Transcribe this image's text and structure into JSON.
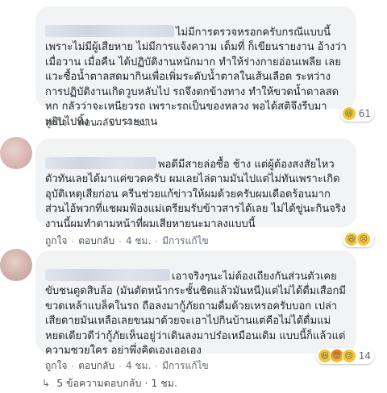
{
  "comments": [
    {
      "text": "ไม่มีการตรวจหรอกครับกรณีแบบนี้ เพราะไม่มีผู้เสียหาย ไม่มีการแจ้งความ เต็มที่ ก็เขียนรายงาน อ้างว่าเมื่อวาน เมื่อคืน ได้ปฏิบัติงานหนักมาก ทำให้ร่างกายอ่อนเพลีย เลยแวะซื้อน้ำตาลสดมากินเพื่อเพิ่มระดับน้ำตาลในเส้นเลือด ระหว่างการปฏิบัติงานเกิดวูบหลับไป รถจึงตกข้างทาง ทำให้ขวดน้ำตาลสดหก กลัวว่าจะเหนียวรถ เพราะรถเป็นของหลวง พอได้สติจึงรีบมาหยิบไปทิ้ง .... จบรายงาน",
      "like": "ถูกใจ",
      "reply": "ตอบกลับ",
      "time": "4 ชม.",
      "edited": "",
      "reactions": [
        "laugh-emoji"
      ],
      "reaction_count": "61"
    },
    {
      "text": "พอดีมีสายล่อซื้อ ช้าง แต่ผู้ต้องสงสัยไหวตัวทันเลยได้มาแค่ขวดครับ ผมเลยไล่ตามมันไปแต่ไม่ทันเพราะเกิดอุบัติเหตุเสียก่อน ครีนช่วยแก้ข่าวให้ผมด้วยครับผมเดือดร้อนมาก ส่วนไอ้พวกที่แชผมฟ้องแม่เตรียมรับข้าวสารได้เลย ไม่ได้ขู่นะกินจริง งานนี้ผมทำตามหน้าที่ผมเสียหายนะมาลงแบบนี้",
      "like": "ถูกใจ",
      "reply": "ตอบกลับ",
      "time": "4 ชม.",
      "edited": "มีการแก้ไข",
      "reactions": [
        "laugh-emoji",
        "sad-emoji"
      ],
      "reaction_count": ""
    },
    {
      "text": "เอาจริงๆนะไม่ต้องเถียงกันส่วนตัวเคยขับชนตูดสิบล้อ (มันตัดหน้ากระชั้นชิดแล้วมันหนี)แต่ไม่ได้ดื่มเสือกมีขวดเหล้าแบล็คในรถ ถือลงมากู้ภัยถามดื่มด้วยเหรอครับบอก เปล่าเสียดายมันเหลือเลยขนมาด้วยจะเอาไปกินบ้านแต่คือไม่ได้ดื่มแม่หยดเดียวดีว่ากู้ภัยเห็นอยู่ว่าเดินลงมาปร๋อเหมือนเดิม แบบนี้ก็แล้วแต่ความซวยใคร อย่าพึ่งคิดเองเออเอง",
      "like": "ถูกใจ",
      "reply": "ตอบกลับ",
      "time": "4 ชม.",
      "edited": "มีการแก้ไข",
      "reactions": [
        "laugh-emoji",
        "angry-emoji",
        "sad-emoji"
      ],
      "reaction_count": "14"
    }
  ],
  "more_replies": "5 ข้อความตอบกลับ · 1 ชม."
}
